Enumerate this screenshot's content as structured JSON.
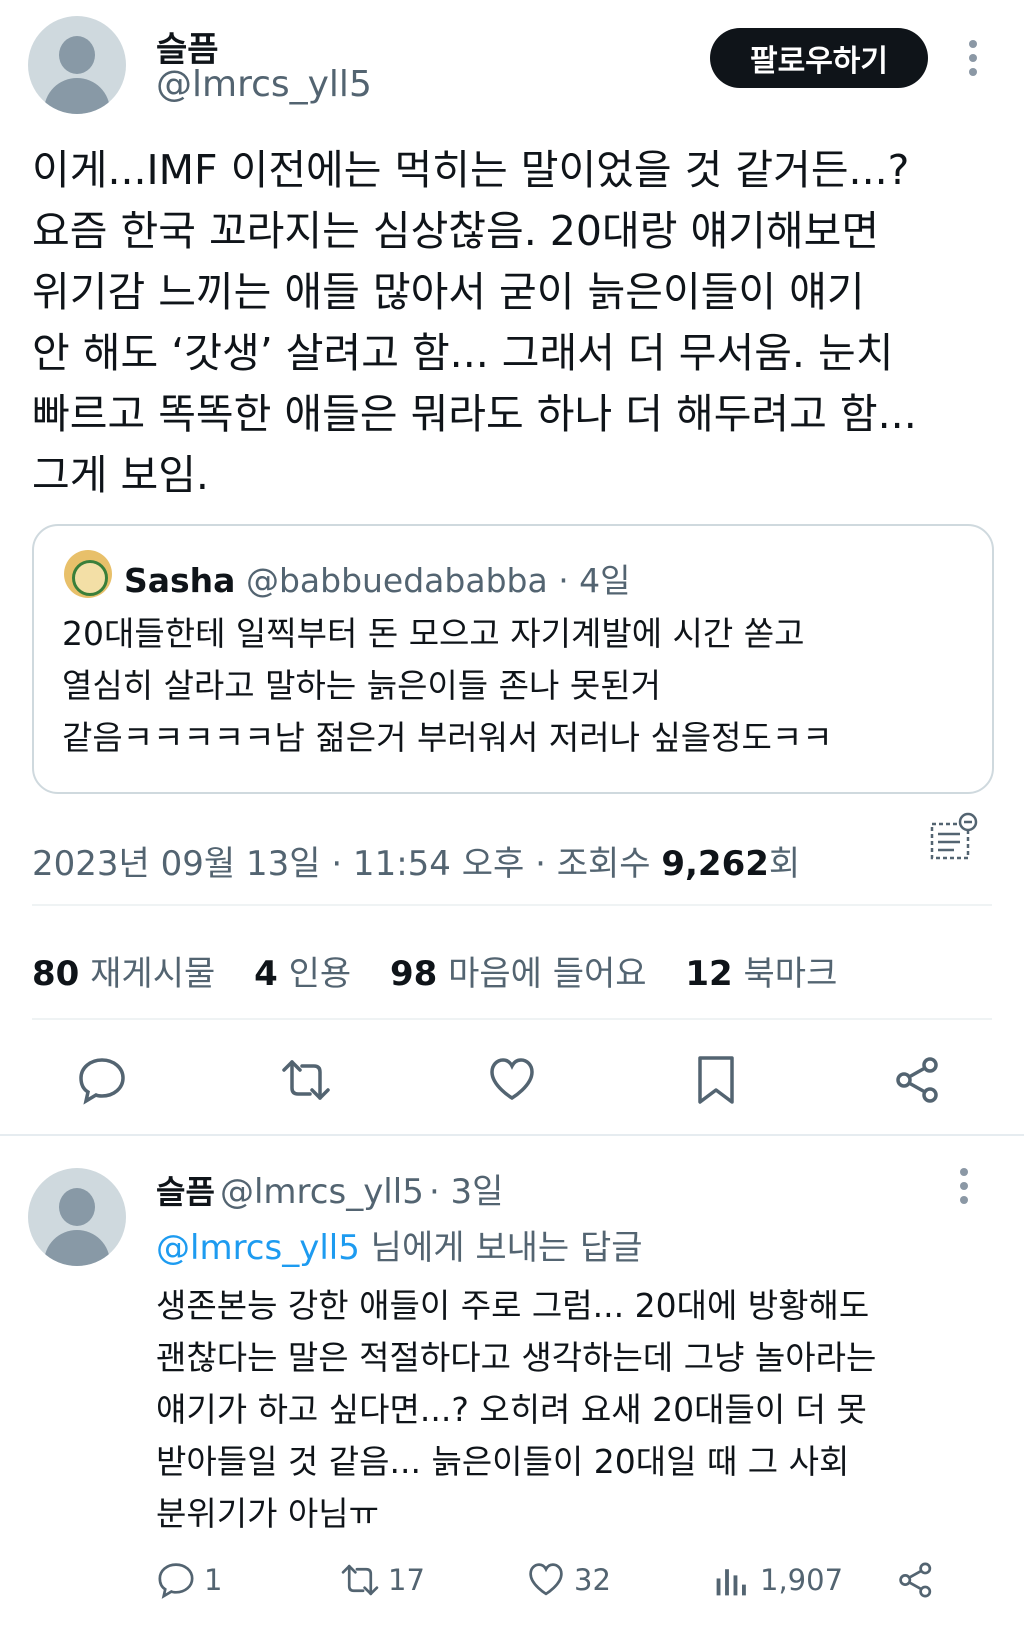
{
  "tweet": {
    "author_name": "슬픔",
    "author_handle": "@lmrcs_yll5",
    "follow_label": "팔로우하기",
    "text_lines": [
      "이게...IMF 이전에는 먹히는 말이었을 것 같거든...?",
      "요즘 한국 꼬라지는 심상찮음. 20대랑 얘기해보면",
      "위기감 느끼는 애들 많아서 굳이 늙은이들이 얘기",
      "안 해도 ‘갓생’ 살려고 함... 그래서 더 무서움. 눈치",
      "빠르고 똑똑한 애들은 뭐라도 하나 더 해두려고 함...",
      "그게 보임."
    ],
    "quote": {
      "name": "Sasha",
      "handle": "@babbuedababba",
      "time": "· 4일",
      "text_lines": [
        "20대들한테 일찍부터 돈 모으고 자기계발에 시간 쏟고",
        "열심히 살라고 말하는 늙은이들 존나 못된거",
        "같음ㅋㅋㅋㅋㅋ남 젊은거 부러워서 저러나 싶을정도ㅋㅋ"
      ]
    },
    "meta": {
      "datetime": "2023년 09월 13일 · 11:54 오후 · 조회수",
      "views": "9,262",
      "views_unit": "회"
    },
    "stats": [
      {
        "num": "80",
        "label": "재게시물"
      },
      {
        "num": "4",
        "label": "인용"
      },
      {
        "num": "98",
        "label": "마음에 들어요"
      },
      {
        "num": "12",
        "label": "북마크"
      }
    ]
  },
  "reply": {
    "author_name": "슬픔",
    "author_handle": "@lmrcs_yll5",
    "time": "· 3일",
    "mention": "@lmrcs_yll5",
    "reply_to_suffix": " 님에게 보내는 답글",
    "text_lines": [
      "생존본능 강한 애들이 주로 그럼... 20대에 방황해도",
      "괜찮다는 말은 적절하다고 생각하는데 그냥 놀아라는",
      "얘기가 하고 싶다면...? 오히려 요새 20대들이 더 못",
      "받아들일 것 같음... 늙은이들이 20대일 때 그 사회",
      "분위기가 아님ㅠ"
    ],
    "counts": {
      "replies": "1",
      "reposts": "17",
      "likes": "32",
      "views": "1,907"
    }
  },
  "icons": [
    "reply-icon",
    "repost-icon",
    "like-icon",
    "bookmark-icon",
    "share-icon",
    "more-icon",
    "view-count-icon",
    "list-icon"
  ]
}
